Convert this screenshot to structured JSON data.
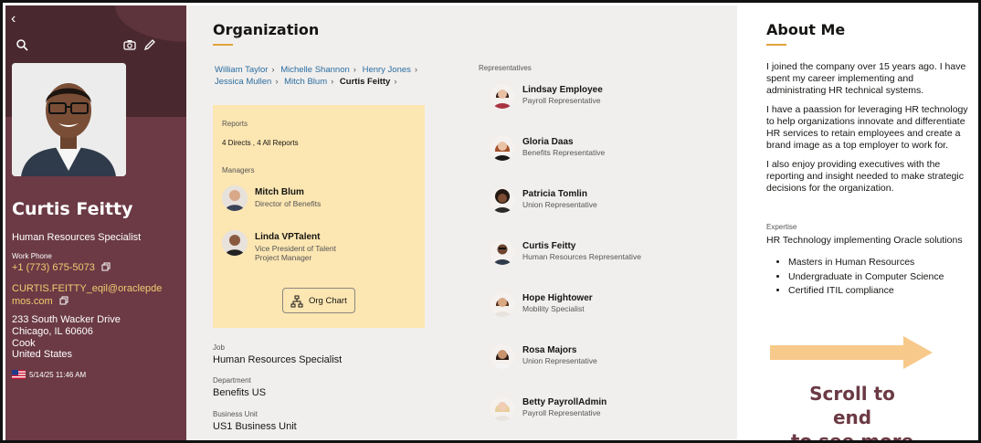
{
  "profile": {
    "name": "Curtis Feitty",
    "job_title": "Human Resources Specialist",
    "work_phone_label": "Work Phone",
    "phone": "+1 (773) 675-5073",
    "email": "CURTIS.FEITTY_eqil@oraclepdemos.com",
    "address": [
      "233 South Wacker Drive",
      "Chicago, IL 60606",
      "Cook",
      "United States"
    ],
    "local_time": "5/14/25 11:46 AM"
  },
  "organization": {
    "title": "Organization",
    "breadcrumbs": [
      "William Taylor",
      "Michelle Shannon",
      "Henry Jones",
      "Jessica Mullen",
      "Mitch Blum"
    ],
    "current": "Curtis Feitty",
    "reports_label": "Reports",
    "reports_value": "4 Directs , 4 All Reports",
    "managers_label": "Managers",
    "managers": [
      {
        "name": "Mitch Blum",
        "role": "Director of Benefits"
      },
      {
        "name": "Linda VPTalent",
        "role": "Vice President of Talent",
        "role2": "Project Manager"
      }
    ],
    "org_chart_button": "Org Chart",
    "job_label": "Job",
    "job_value": "Human Resources Specialist",
    "department_label": "Department",
    "department_value": "Benefits US",
    "business_unit_label": "Business Unit",
    "business_unit_value": "US1 Business Unit"
  },
  "representatives": {
    "label": "Representatives",
    "items": [
      {
        "name": "Lindsay Employee",
        "role": "Payroll Representative"
      },
      {
        "name": "Gloria Daas",
        "role": "Benefits Representative"
      },
      {
        "name": "Patricia Tomlin",
        "role": "Union Representative"
      },
      {
        "name": "Curtis Feitty",
        "role": "Human Resources Representative"
      },
      {
        "name": "Hope Hightower",
        "role": "Mobility Specialist"
      },
      {
        "name": "Rosa Majors",
        "role": "Union Representative"
      },
      {
        "name": "Betty PayrollAdmin",
        "role": "Payroll Representative"
      }
    ]
  },
  "about": {
    "title": "About Me",
    "paragraphs": [
      "I joined the company over 15 years ago.  I have spent my career implementing and administrating HR technical systems.",
      "I have a paassion for leveraging HR technology to help organizations innovate and differentiate HR services to retain employees and create a brand image as a top employer to work for.",
      "I also enjoy providing executives with the reporting and insight needed to make strategic decisions for the organization."
    ],
    "expertise_label": "Expertise",
    "expertise_value": "HR Technology implementing Oracle solutions",
    "expertise_items": [
      "Masters in Human Resources",
      "Undergraduate in Computer Science",
      "Certified ITIL compliance"
    ]
  },
  "callout": {
    "line1": "Scroll to end",
    "line2": "to see more",
    "arrow_color": "#f7c98a"
  }
}
